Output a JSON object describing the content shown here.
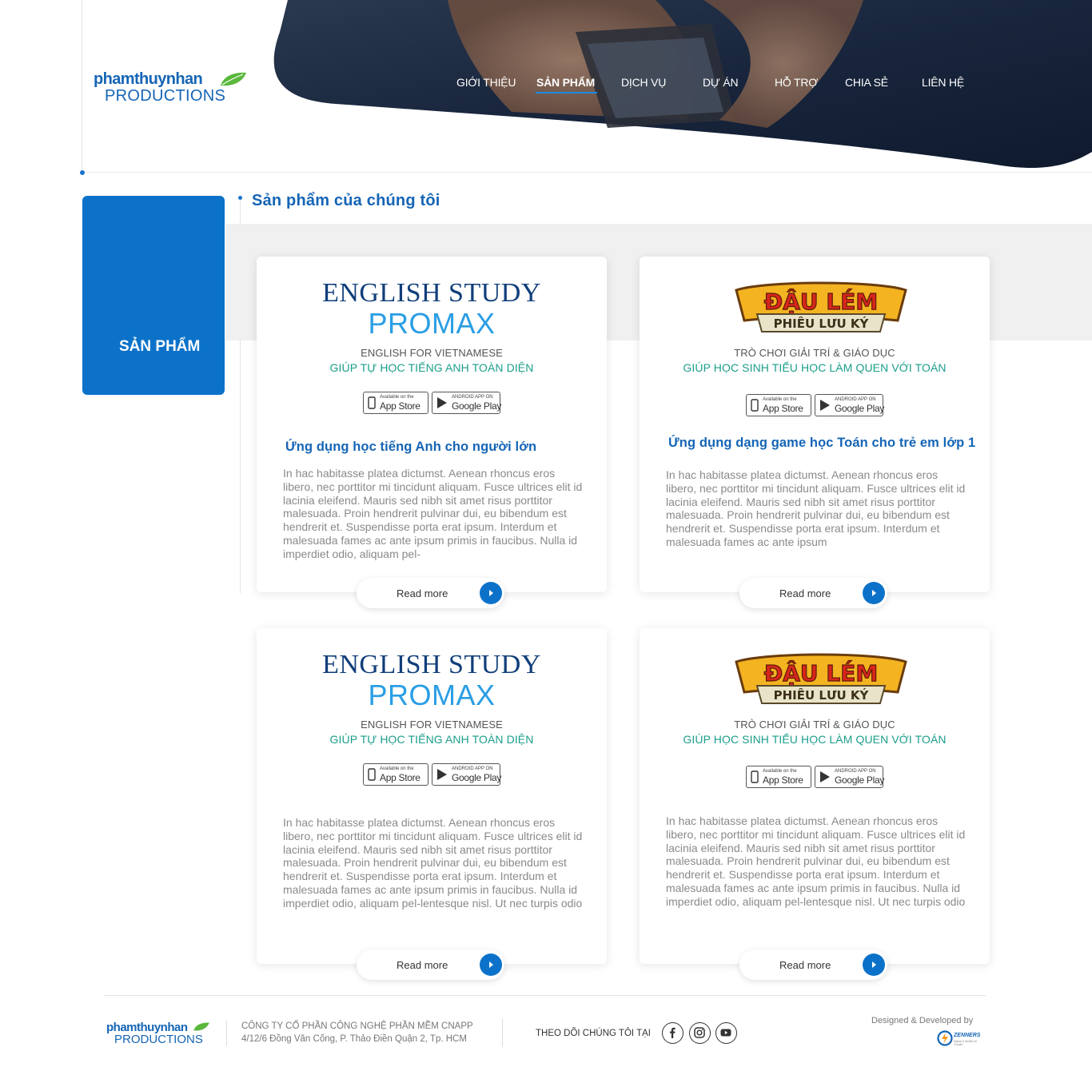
{
  "brand": {
    "logo_line1": "phamthuynhan",
    "logo_line2": "PRODUCTIONS",
    "primary_color": "#0c72c9",
    "dark_color": "#14223a"
  },
  "nav": {
    "items": [
      {
        "label": "GIỚI THIỆU"
      },
      {
        "label": "SẢN PHẨM",
        "active": true
      },
      {
        "label": "DỊCH VỤ"
      },
      {
        "label": "DỰ ÁN"
      },
      {
        "label": "HỖ TRỢ"
      },
      {
        "label": "CHIA SẺ"
      },
      {
        "label": "LIÊN HỆ"
      }
    ]
  },
  "sidebar": {
    "title": "SẢN PHẨM"
  },
  "section": {
    "title": "Sản phẩm của chúng tôi"
  },
  "cards": [
    {
      "logo_line1": "ENGLISH STUDY",
      "logo_line2": "PROMAX",
      "tagline1": "ENGLISH FOR VIETNAMESE",
      "tagline2": "GIÚP TỰ HỌC TIẾNG ANH TOÀN DIỆN",
      "appstore_small": "Available on the",
      "appstore_big": "App Store",
      "googleplay_small": "ANDROID APP ON",
      "googleplay_big": "Google Play",
      "title": "Ứng dụng học tiếng Anh cho người lớn",
      "description": "In hac habitasse platea dictumst. Aenean rhoncus eros libero, nec porttitor mi tincidunt aliquam. Fusce ultrices elit id lacinia eleifend. Mauris sed nibh sit amet risus porttitor malesuada. Proin hendrerit pulvinar dui, eu bibendum est hendrerit et. Suspendisse porta erat ipsum. Interdum et malesuada fames ac ante ipsum primis in faucibus. Nulla id imperdiet odio, aliquam pel-",
      "read_more": "Read more"
    },
    {
      "logo_line1": "ĐẬU LÉM",
      "logo_line2": "PHIÊU LƯU KÝ",
      "tagline1": "TRÒ CHƠI GIẢI TRÍ & GIÁO DỤC",
      "tagline2": "GIÚP HỌC SINH TIỂU HỌC LÀM QUEN VỚI TOÁN",
      "appstore_small": "Available on the",
      "appstore_big": "App Store",
      "googleplay_small": "ANDROID APP ON",
      "googleplay_big": "Google Play",
      "title": "Ứng dụng dạng game học Toán cho trẻ em lớp 1",
      "description": "In hac habitasse platea dictumst. Aenean rhoncus eros libero, nec porttitor mi tincidunt aliquam. Fusce ultrices elit id lacinia eleifend. Mauris sed nibh sit amet risus porttitor malesuada. Proin hendrerit pulvinar dui, eu bibendum est hendrerit et. Suspendisse porta erat ipsum. Interdum et malesuada fames ac ante ipsum",
      "read_more": "Read more"
    },
    {
      "logo_line1": "ENGLISH STUDY",
      "logo_line2": "PROMAX",
      "tagline1": "ENGLISH FOR VIETNAMESE",
      "tagline2": "GIÚP TỰ HỌC TIẾNG ANH TOÀN DIỆN",
      "appstore_small": "Available on the",
      "appstore_big": "App Store",
      "googleplay_small": "ANDROID APP ON",
      "googleplay_big": "Google Play",
      "title": "",
      "description": "In hac habitasse platea dictumst. Aenean rhoncus eros libero, nec porttitor mi tincidunt aliquam. Fusce ultrices elit id lacinia eleifend. Mauris sed nibh sit amet risus porttitor malesuada. Proin hendrerit pulvinar dui, eu bibendum est hendrerit et. Suspendisse porta erat ipsum. Interdum et malesuada fames ac ante ipsum primis in faucibus. Nulla id imperdiet odio, aliquam pel-lentesque nisl. Ut nec turpis odio",
      "read_more": "Read more"
    },
    {
      "logo_line1": "ĐẬU LÉM",
      "logo_line2": "PHIÊU LƯU KÝ",
      "tagline1": "TRÒ CHƠI GIẢI TRÍ & GIÁO DỤC",
      "tagline2": "GIÚP HỌC SINH TIỂU HỌC LÀM QUEN VỚI TOÁN",
      "appstore_small": "Available on the",
      "appstore_big": "App Store",
      "googleplay_small": "ANDROID APP ON",
      "googleplay_big": "Google Play",
      "title": "",
      "description": "In hac habitasse platea dictumst. Aenean rhoncus eros libero, nec porttitor mi tincidunt aliquam. Fusce ultrices elit id lacinia eleifend. Mauris sed nibh sit amet risus porttitor malesuada. Proin hendrerit pulvinar dui, eu bibendum est hendrerit et. Suspendisse porta erat ipsum. Interdum et malesuada fames ac ante ipsum primis in faucibus. Nulla id imperdiet odio, aliquam pel-lentesque nisl. Ut nec turpis odio",
      "read_more": "Read more"
    }
  ],
  "footer": {
    "logo_line1": "phamthuynhan",
    "logo_line2": "PRODUCTIONS",
    "company": "CÔNG TY CỔ PHẦN CÔNG NGHỆ PHẦN MỀM CNAPP",
    "address": "4/12/6 Đồng Văn Cống, P. Thảo Điền Quận 2, Tp. HCM",
    "follow_label": "THEO DÕI CHÚNG TÔI TẠI",
    "social": [
      "facebook-icon",
      "instagram-icon",
      "youtube-icon"
    ],
    "designed_by": "Designed & Developed by",
    "designer_name": "ZENNERS",
    "designer_tagline": "Digital & Mobile for Growth"
  }
}
